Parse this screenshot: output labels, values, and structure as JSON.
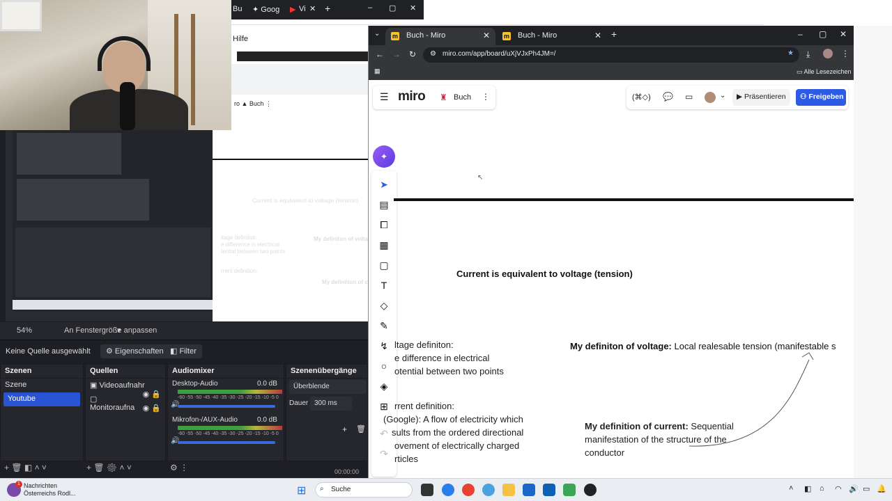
{
  "obs": {
    "zoom_label": "54%",
    "fit_label": "An Fenstergröße anpassen",
    "no_source_label": "Keine Quelle ausgewählt",
    "properties_label": "Eigenschaften",
    "filter_label": "Filter",
    "scenes": {
      "title": "Szenen",
      "items": [
        "Szene",
        "Youtube"
      ],
      "selected": "Youtube"
    },
    "sources": {
      "title": "Quellen",
      "items": [
        "Videoaufnahr",
        "Monitoraufna"
      ]
    },
    "mixer": {
      "title": "Audiomixer",
      "channels": [
        {
          "name": "Desktop-Audio",
          "db": "0.0 dB"
        },
        {
          "name": "Mikrofon-/AUX-Audio",
          "db": "0.0 dB"
        }
      ],
      "scale": "-60 -55 -50 -45 -40 -35 -30 -25 -20 -15 -10 -5 0"
    },
    "transitions": {
      "title": "Szenenübergänge",
      "type": "Überblende",
      "duration_label": "Dauer",
      "duration": "300 ms"
    },
    "timecode": "00:00:00"
  },
  "preview": {
    "current_text": "Current is equivalent to voltage (tension)",
    "voltage_def_title": "ltage definiton:",
    "voltage_def_lines": [
      "e difference in electrical",
      "tential between two points"
    ],
    "current_def_title": "rrent definition:",
    "my_voltage": "My definiton of volta",
    "my_current": "My definition of c"
  },
  "bg": {
    "hilfe": "Hilfe",
    "tab1": "Bu",
    "tab2": "Goog",
    "tab3": "Vi"
  },
  "chrome": {
    "tabs": [
      {
        "title": "Buch - Miro"
      },
      {
        "title": "Buch - Miro"
      }
    ],
    "url": "miro.com/app/board/uXjVJxPh4JM=/",
    "bookmarks_label": "Alle Lesezeichen"
  },
  "miro": {
    "logo": "miro",
    "board_name": "Buch",
    "present_label": "Präsentieren",
    "share_label": "Freigeben",
    "reactions_label": "(⌘◇)",
    "canvas": {
      "heading": "Current is equivalent to voltage (tension)",
      "voltage_def_title": "ltage definiton:",
      "voltage_def_lines": [
        "e difference in electrical",
        "otential between two points"
      ],
      "current_def_title": "rrent definition:",
      "current_def_lines": [
        "(Google): A flow of electricity which",
        "sults from the ordered directional",
        "ovement of electrically charged",
        "rticles"
      ],
      "my_voltage_bold": "My definiton of voltage:",
      "my_voltage_rest": " Local realesable tension (manifestable s",
      "my_current_bold": "My definition of current:",
      "my_current_rest_1": " Sequential",
      "my_current_rest_2": "manifestation of the structure of the",
      "my_current_rest_3": "conductor"
    }
  },
  "taskbar": {
    "news_title": "Nachrichten",
    "news_sub": "Österreichs Rodl...",
    "search_label": "Suche",
    "badge": "1"
  }
}
